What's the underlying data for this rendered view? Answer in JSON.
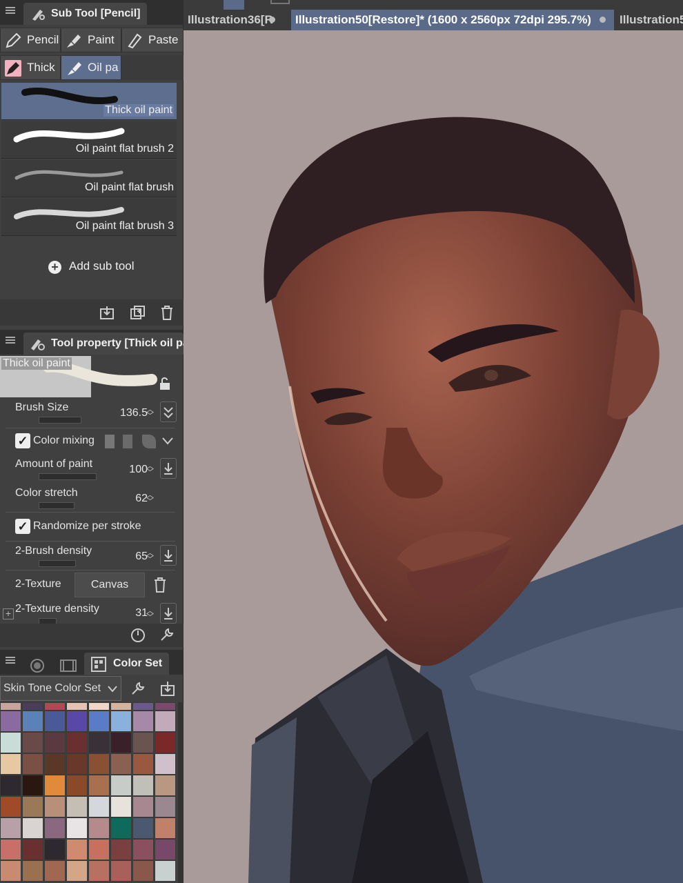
{
  "subtool": {
    "title": "Sub Tool [Pencil]",
    "groups": [
      {
        "label": "Pencil",
        "icon": "pencil-icon"
      },
      {
        "label": "Paint",
        "icon": "paint-icon"
      },
      {
        "label": "Paste",
        "icon": "pastel-icon"
      },
      {
        "label": "Thick",
        "icon": "thick-paint-icon"
      },
      {
        "label": "Oil pa",
        "icon": "oil-paint-icon"
      }
    ],
    "brushes": [
      {
        "label": "Thick oil paint",
        "selected": true
      },
      {
        "label": "Oil paint flat brush 2",
        "selected": false
      },
      {
        "label": "Oil paint flat brush",
        "selected": false
      },
      {
        "label": "Oil paint flat brush 3",
        "selected": false
      }
    ],
    "add_label": "Add sub tool"
  },
  "toolprop": {
    "title": "Tool property [Thick oil pa",
    "preview_label": "Thick oil paint",
    "brush_size_label": "Brush Size",
    "brush_size": "136.5",
    "color_mixing_label": "Color mixing",
    "amount_label": "Amount of paint",
    "amount": "100",
    "stretch_label": "Color stretch",
    "stretch": "62",
    "randomize_label": "Randomize per stroke",
    "density_label": "2-Brush density",
    "density": "65",
    "texture_label": "2-Texture",
    "texture_value": "Canvas",
    "texture_density_label": "2-Texture density",
    "texture_density": "31"
  },
  "colorset": {
    "title": "Color Set",
    "set_name": "Skin Tone Color Set",
    "top_strip": [
      "#c8a59a",
      "#4a3d5c",
      "#b04a52",
      "#e6c2b0",
      "#f0d6c4",
      "#d6b39a",
      "#6a5a8a",
      "#7a4a6a"
    ],
    "rows": [
      [
        "#8a6aa0",
        "#5a82b8",
        "#4a5a98",
        "#5a48a8",
        "#5a7cc8",
        "#8ab0dc",
        "#a688a8",
        "#c2aaba"
      ],
      [
        "#c8dcd8",
        "#6a4a48",
        "#5a3a40",
        "#6a3030",
        "#3a3038",
        "#3a2028",
        "#6a5450",
        "#7a2828"
      ],
      [
        "#e6c8a2",
        "#7a5044",
        "#5a3828",
        "#6a3828",
        "#8a5034",
        "#8a6050",
        "#9a5840",
        "#d0c0cc"
      ],
      [
        "#2e2830",
        "#2a1810",
        "#e08a3a",
        "#8a4a2a",
        "#a8704e",
        "#c8ccc8",
        "#c0c0b8",
        "#b89880"
      ],
      [
        "#a04a28",
        "#9a7858",
        "#b89078",
        "#c4beb4",
        "#d4d8dc",
        "#e8e2dc",
        "#a88890",
        "#9a8890"
      ],
      [
        "#b8a0a8",
        "#d8d4d2",
        "#8a6880",
        "#e8e4e6",
        "#b48a8c",
        "#0e6a5a",
        "#4a5870",
        "#c0806a"
      ],
      [
        "#c87068",
        "#6a3030",
        "#2e2830",
        "#d08a70",
        "#c87060",
        "#7a4040",
        "#8a5060",
        "#784868"
      ],
      [
        "#c88a70",
        "#9a7050",
        "#a06850",
        "#d4a688",
        "#b87060",
        "#a86058",
        "#8a5848",
        "#c8d0d0"
      ]
    ]
  },
  "tabs": [
    {
      "label": "Illustration36[R",
      "active": false
    },
    {
      "label": "Illustration50[Restore]* (1600 x 2560px 72dpi 295.7%)",
      "active": true
    },
    {
      "label": "Illustration5",
      "active": false
    }
  ]
}
